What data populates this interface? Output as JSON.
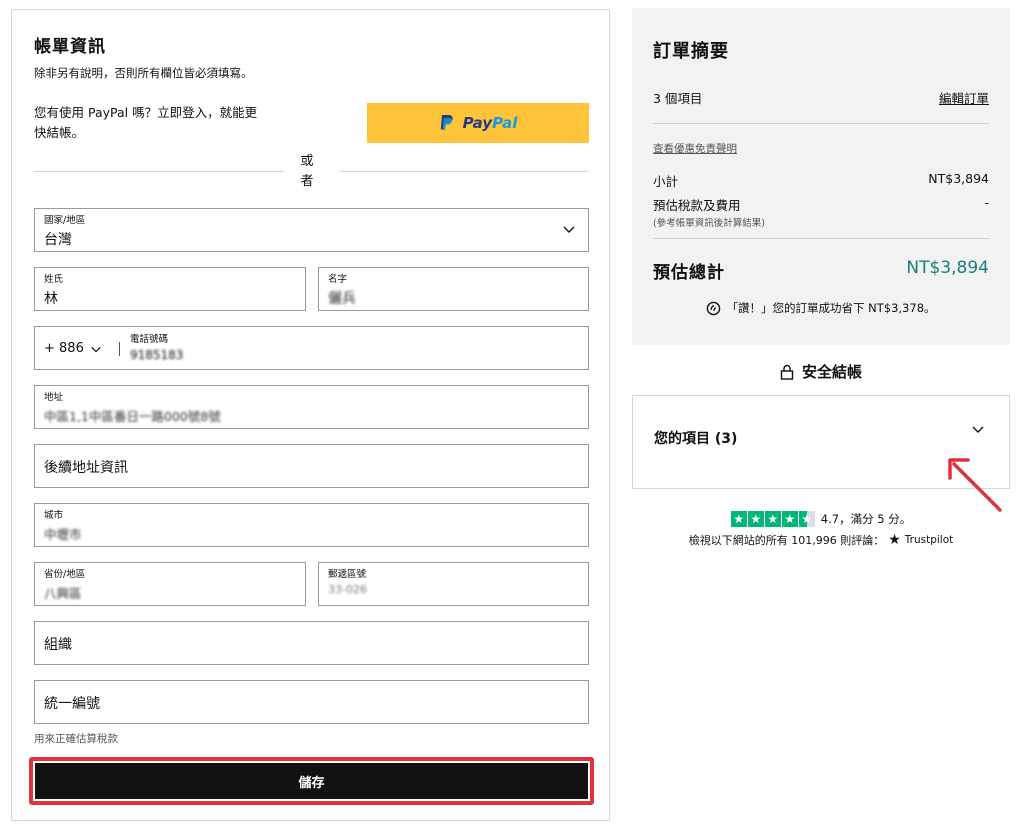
{
  "billing": {
    "title": "帳單資訊",
    "subtitle": "除非另有說明，否則所有欄位皆必須填寫。",
    "paypal_prompt": "您有使用 PayPal 嗎？立即登入，就能更快結帳。",
    "paypal_button": "PayPal",
    "or_label": "或者",
    "country": {
      "label": "國家/地區",
      "value": "台灣"
    },
    "last_name": {
      "label": "姓氏",
      "value": "林"
    },
    "first_name": {
      "label": "名字",
      "value": "儷兵"
    },
    "phone": {
      "country_code": "+ 886",
      "label": "電話號碼",
      "value": "9185183"
    },
    "address": {
      "label": "地址",
      "value": "中區1,1中區番日一路000號8號"
    },
    "address2": {
      "placeholder": "後續地址資訊"
    },
    "city": {
      "label": "城市",
      "value": "中壢市"
    },
    "province": {
      "label": "省份/地區",
      "value": "八興區"
    },
    "postal": {
      "label": "郵遞區號",
      "value": "33-026"
    },
    "organization": {
      "placeholder": "組織"
    },
    "tax_id": {
      "placeholder": "統一編號"
    },
    "tax_hint": "用來正確估算稅款",
    "save_label": "儲存"
  },
  "summary": {
    "title": "訂單摘要",
    "item_count": "3 個項目",
    "edit_order": "編輯訂單",
    "promo_link": "查看優惠免責聲明",
    "subtotal_label": "小計",
    "subtotal_value": "NT$3,894",
    "tax_label": "預估稅款及費用",
    "tax_value": "-",
    "tax_note": "(參考帳單資訊後計算結果)",
    "total_label": "預估總計",
    "total_value": "NT$3,894",
    "savings_text": "「讚！」您的訂單成功省下 NT$3,378。"
  },
  "secure_checkout": "安全結帳",
  "your_items": "您的項目 (3)",
  "trustpilot": {
    "rating_text": "4.7，滿分 5 分。",
    "reviews_text": "檢視以下網站的所有 101,996 則評論：",
    "brand": "Trustpilot",
    "rating": 4.7
  },
  "colors": {
    "paypal_yellow": "#ffc439",
    "total_green": "#1a7f7a",
    "highlight_red": "#e0323c",
    "trustpilot_green": "#00b67a"
  }
}
